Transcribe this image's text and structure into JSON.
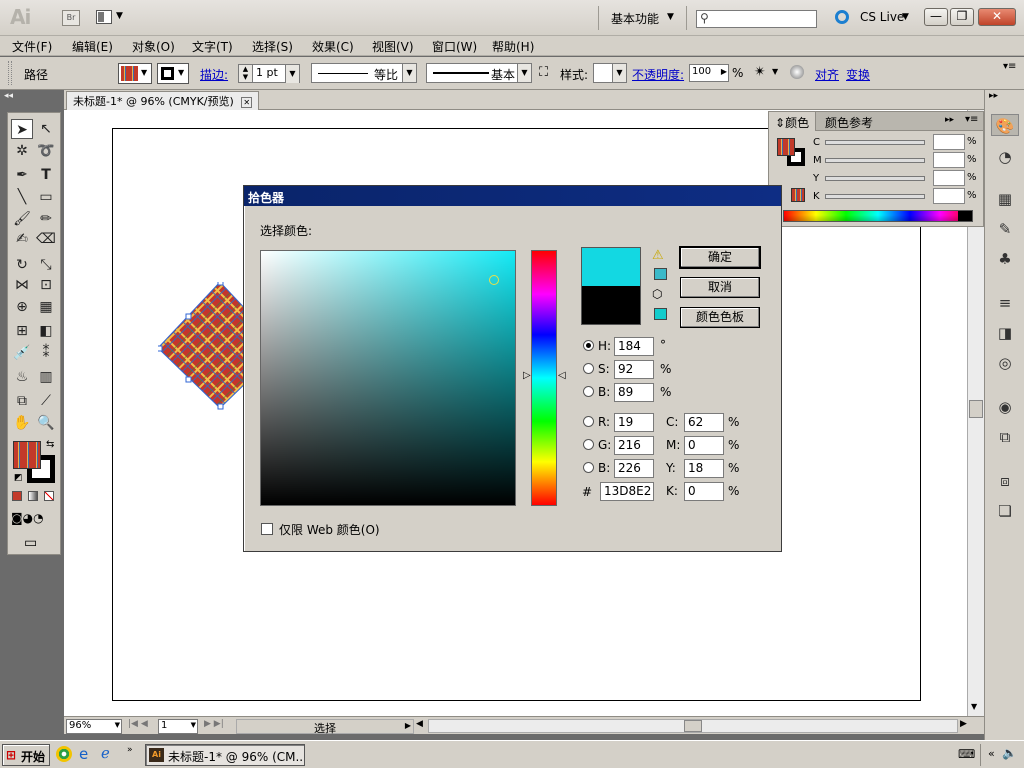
{
  "app": {
    "logo": "Ai",
    "bridge": "Br",
    "workspace": "基本功能",
    "cs_live": "CS Live",
    "search_placeholder": ""
  },
  "menu": [
    "文件(F)",
    "编辑(E)",
    "对象(O)",
    "文字(T)",
    "选择(S)",
    "效果(C)",
    "视图(V)",
    "窗口(W)",
    "帮助(H)"
  ],
  "control": {
    "object_type": "路径",
    "stroke_label": "描边:",
    "stroke_weight": "1 pt",
    "profile_1": "等比",
    "profile_2": "基本",
    "style_label": "样式:",
    "opacity_label": "不透明度:",
    "opacity_value": "100",
    "opacity_unit": "%",
    "align_link": "对齐",
    "transform_link": "变换"
  },
  "document": {
    "tab_title": "未标题-1* @ 96% (CMYK/预览)"
  },
  "status": {
    "zoom": "96%",
    "artboard": "1",
    "mode": "选择"
  },
  "color_panel": {
    "tab_color": "颜色",
    "tab_guide": "颜色参考",
    "channels": [
      {
        "label": "C",
        "value": "",
        "unit": "%"
      },
      {
        "label": "M",
        "value": "",
        "unit": "%"
      },
      {
        "label": "Y",
        "value": "",
        "unit": "%"
      },
      {
        "label": "K",
        "value": "",
        "unit": "%"
      }
    ]
  },
  "picker": {
    "title": "拾色器",
    "select_label": "选择颜色:",
    "ok": "确定",
    "cancel": "取消",
    "swatches": "颜色色板",
    "web_only": "仅限 Web 颜色(O)",
    "new_color": "#13D8E2",
    "old_color": "#000000",
    "hsb": [
      {
        "label": "H:",
        "value": "184",
        "unit": "°",
        "selected": true
      },
      {
        "label": "S:",
        "value": "92",
        "unit": "%",
        "selected": false
      },
      {
        "label": "B:",
        "value": "89",
        "unit": "%",
        "selected": false
      }
    ],
    "rgb": [
      {
        "label": "R:",
        "value": "19"
      },
      {
        "label": "G:",
        "value": "216"
      },
      {
        "label": "B:",
        "value": "226"
      }
    ],
    "cmyk": [
      {
        "label": "C:",
        "value": "62",
        "unit": "%"
      },
      {
        "label": "M:",
        "value": "0",
        "unit": "%"
      },
      {
        "label": "Y:",
        "value": "18",
        "unit": "%"
      },
      {
        "label": "K:",
        "value": "0",
        "unit": "%"
      }
    ],
    "hex_label": "#",
    "hex_value": "13D8E2"
  },
  "taskbar": {
    "start": "开始",
    "task": "未标题-1* @ 96% (CM..."
  },
  "colors": {
    "accent_title": "#0a246a",
    "selected_cyan": "#13D8E2",
    "link": "#0000c8"
  }
}
